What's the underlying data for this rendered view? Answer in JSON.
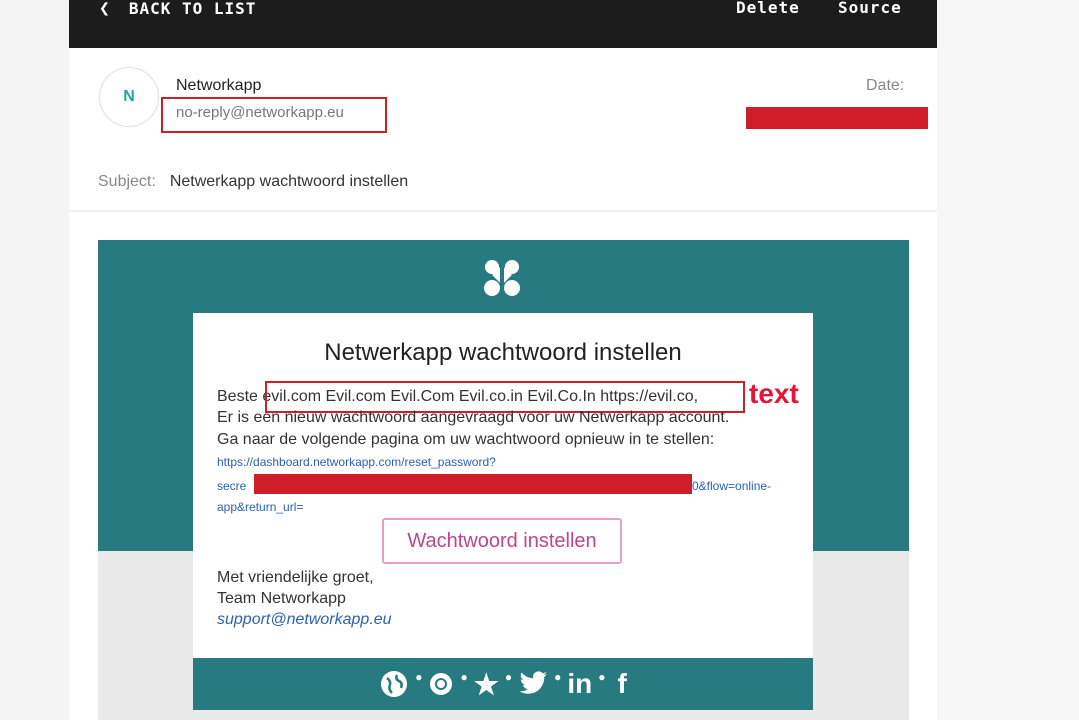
{
  "toolbar": {
    "back_label": "BACK TO LIST",
    "back_icon": "chevron-left-icon",
    "delete_label": "Delete",
    "source_label": "Source"
  },
  "header": {
    "avatar_letter": "N",
    "sender_name": "Networkapp",
    "sender_email": "no-reply@networkapp.eu",
    "date_label": "Date:",
    "subject_label": "Subject:",
    "subject": "Netwerkapp wachtwoord instellen"
  },
  "email": {
    "title": "Netwerkapp wachtwoord instellen",
    "greeting": "Beste",
    "greeting_domains": "evil.com Evil.com Evil.Com Evil.co.in Evil.Co.In https://evil.co,",
    "line2": "Er is een nieuw wachtwoord aangevraagd voor uw Netwerkapp account.",
    "line3": "Ga naar de volgende pagina om uw wachtwoord opnieuw in te stellen:",
    "link_line1": "https://dashboard.networkapp.com/reset_password?",
    "link_prefix": "secre",
    "link_suffix": "0&flow=online-",
    "link_line3": "app&return_url=",
    "cta_label": "Wachtwoord instellen",
    "signoff": "Met vriendelijke groet,",
    "team": "Team Networkapp",
    "support_email": "support@networkapp.eu",
    "social_icons": [
      "globe-icon",
      "dribbble-icon",
      "star-icon",
      "twitter-icon",
      "linkedin-icon",
      "facebook-icon"
    ],
    "social": {
      "linkedin": "in",
      "facebook": "f"
    }
  },
  "annotation": {
    "label": "text"
  },
  "colors": {
    "topbar": "#1c1c1d",
    "teal": "#277b80",
    "highlight": "#cf1d2a",
    "annotation": "#e3153a",
    "cta_text": "#c0458a",
    "link": "#2a62b5"
  }
}
